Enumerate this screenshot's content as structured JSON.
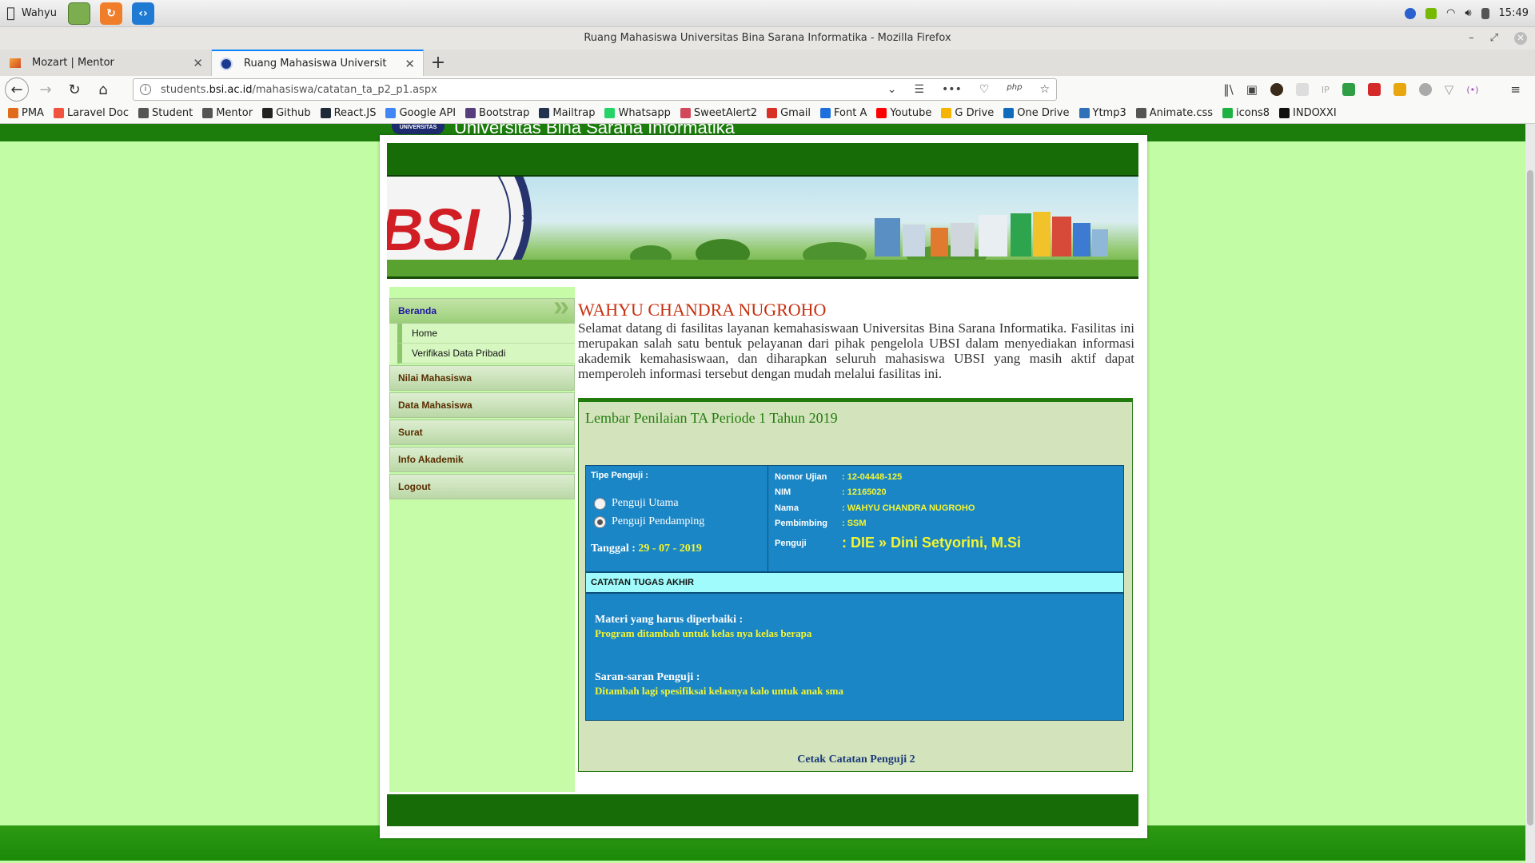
{
  "os_bar": {
    "user": "Wahyu",
    "clock": "15:49"
  },
  "window": {
    "title": "Ruang Mahasiswa Universitas Bina Sarana Informatika - Mozilla Firefox"
  },
  "tabs": [
    {
      "label": "Mozart | Mentor",
      "active": false
    },
    {
      "label": "Ruang Mahasiswa Universit",
      "active": true
    }
  ],
  "url": {
    "prefix": "students.",
    "host": "bsi.ac.id",
    "path": "/mahasiswa/catatan_ta_p2_p1.aspx"
  },
  "bookmarks": [
    {
      "label": "PMA",
      "icon": "pma-icon",
      "color": "#e06c1b"
    },
    {
      "label": "Laravel Doc",
      "icon": "laravel-icon",
      "color": "#f05340"
    },
    {
      "label": "Student",
      "icon": "globe-icon",
      "color": "#555555"
    },
    {
      "label": "Mentor",
      "icon": "globe-icon",
      "color": "#555555"
    },
    {
      "label": "Github",
      "icon": "github-icon",
      "color": "#222222"
    },
    {
      "label": "React.JS",
      "icon": "react-icon",
      "color": "#1f2a38"
    },
    {
      "label": "Google API",
      "icon": "google-icon",
      "color": "#4285f4"
    },
    {
      "label": "Bootstrap",
      "icon": "bootstrap-icon",
      "color": "#563d7c"
    },
    {
      "label": "Mailtrap",
      "icon": "mailtrap-icon",
      "color": "#22314f"
    },
    {
      "label": "Whatsapp",
      "icon": "whatsapp-icon",
      "color": "#25d366"
    },
    {
      "label": "SweetAlert2",
      "icon": "sweetalert-icon",
      "color": "#d1495b"
    },
    {
      "label": "Gmail",
      "icon": "gmail-icon",
      "color": "#d93025"
    },
    {
      "label": "Font A",
      "icon": "fontawesome-icon",
      "color": "#1d6fdc"
    },
    {
      "label": "Youtube",
      "icon": "youtube-icon",
      "color": "#ff0000"
    },
    {
      "label": "G Drive",
      "icon": "gdrive-icon",
      "color": "#f4b400"
    },
    {
      "label": "One Drive",
      "icon": "onedrive-icon",
      "color": "#0f6cbd"
    },
    {
      "label": "Ytmp3",
      "icon": "ytmp3-icon",
      "color": "#2f71b8"
    },
    {
      "label": "Animate.css",
      "icon": "globe-icon",
      "color": "#555555"
    },
    {
      "label": "icons8",
      "icon": "icons8-icon",
      "color": "#1fb141"
    },
    {
      "label": "INDOXXI",
      "icon": "indoxxi-icon",
      "color": "#111111"
    }
  ],
  "site": {
    "badge": "UNIVERSITAS",
    "name": "Universitas Bina Sarana Informatika",
    "logo_text": "BSI"
  },
  "sidebar": {
    "active_menu": "Beranda",
    "submenu": [
      "Home",
      "Verifikasi Data Pribadi"
    ],
    "menus": [
      "Nilai Mahasiswa",
      "Data Mahasiswa",
      "Surat",
      "Info Akademik",
      "Logout"
    ]
  },
  "main": {
    "student_name": "WAHYU CHANDRA NUGROHO",
    "welcome": "Selamat datang di fasilitas layanan kemahasiswaan Universitas Bina Sarana Informatika. Fasilitas ini merupakan salah satu bentuk pelayanan dari pihak pengelola UBSI dalam menyediakan informasi akademik kemahasiswaan, dan diharapkan seluruh mahasiswa UBSI yang masih aktif dapat memperoleh informasi tersebut dengan mudah melalui fasilitas ini."
  },
  "panel": {
    "title": "Lembar Penilaian TA Periode 1 Tahun 2019",
    "tipe_label": "Tipe Penguji :",
    "radio_options": [
      {
        "label": "Penguji Utama",
        "checked": false
      },
      {
        "label": "Penguji Pendamping",
        "checked": true
      }
    ],
    "tanggal_label": "Tanggal :",
    "tanggal_value": "29 - 07 - 2019",
    "details": [
      {
        "key": "Nomor Ujian",
        "value": ": 12-04448-125"
      },
      {
        "key": "NIM",
        "value": ": 12165020"
      },
      {
        "key": "Nama",
        "value": ": WAHYU CHANDRA NUGROHO"
      },
      {
        "key": "Pembimbing",
        "value": ": SSM"
      },
      {
        "key": "Penguji",
        "value": ": DIE » Dini Setyorini, M.Si"
      }
    ],
    "catatan_head": "CATATAN TUGAS AKHIR",
    "materi_label": "Materi yang harus diperbaiki :",
    "materi_value": "Program ditambah untuk kelas nya kelas berapa",
    "saran_label": "Saran-saran Penguji :",
    "saran_value": "Ditambah lagi spesifiksai kelasnya kalo untuk anak sma",
    "cetak_link": "Cetak Catatan Penguji 2"
  }
}
